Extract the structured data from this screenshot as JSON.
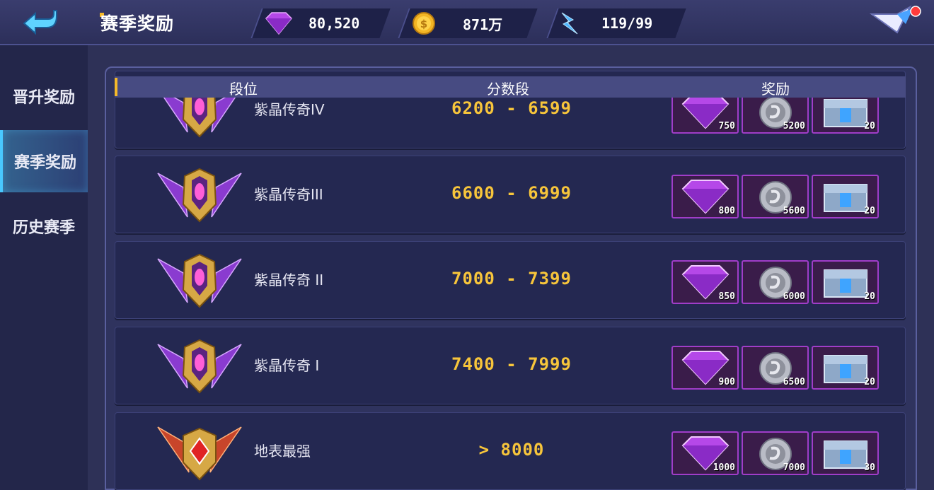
{
  "header": {
    "title": "赛季奖励",
    "resources": [
      {
        "icon": "diamond-icon",
        "value": "80,520"
      },
      {
        "icon": "gold-coin-icon",
        "value": "871万"
      },
      {
        "icon": "energy-icon",
        "value": "119/99"
      }
    ]
  },
  "sidebar": {
    "items": [
      {
        "label": "晋升奖励"
      },
      {
        "label": "赛季奖励"
      },
      {
        "label": "历史赛季"
      }
    ],
    "active_index": 1
  },
  "table": {
    "columns": [
      "段位",
      "分数段",
      "奖励"
    ],
    "rows": [
      {
        "rank": "紫晶传奇IV",
        "range": "6200 - 6599",
        "rewards": [
          "750",
          "5200",
          "20"
        ]
      },
      {
        "rank": "紫晶传奇III",
        "range": "6600 - 6999",
        "rewards": [
          "800",
          "5600",
          "20"
        ]
      },
      {
        "rank": "紫晶传奇 II",
        "range": "7000 - 7399",
        "rewards": [
          "850",
          "6000",
          "20"
        ]
      },
      {
        "rank": "紫晶传奇 I",
        "range": "7400 - 7999",
        "rewards": [
          "900",
          "6500",
          "20"
        ]
      },
      {
        "rank": "地表最强",
        "range": "> 8000",
        "rewards": [
          "1000",
          "7000",
          "30"
        ]
      }
    ]
  },
  "colors": {
    "accent": "#f5b92a",
    "score": "#f7c53b",
    "reward_border": "#a03dc8",
    "active_tab": "#49c8ff"
  }
}
